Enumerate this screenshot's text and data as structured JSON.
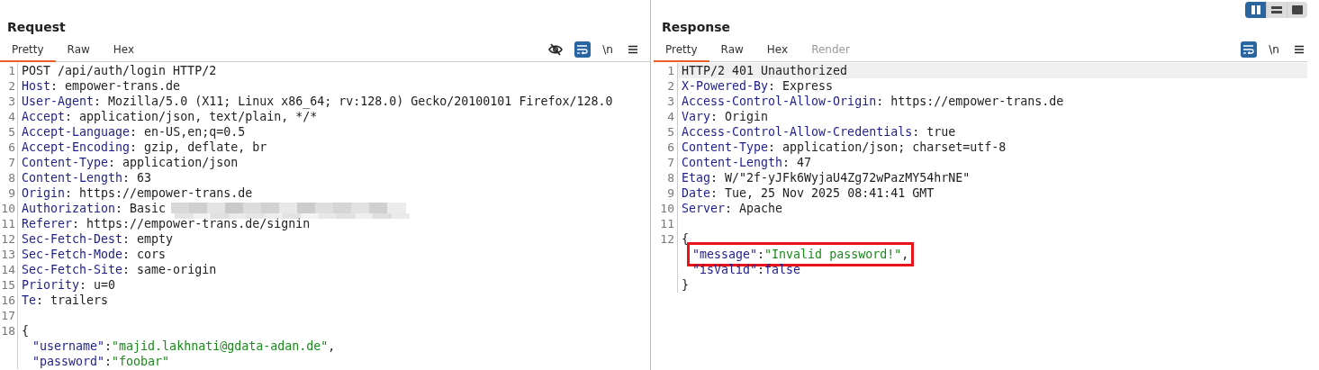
{
  "request": {
    "title": "Request",
    "tabs": [
      {
        "label": "Pretty",
        "selected": true,
        "disabled": false
      },
      {
        "label": "Raw",
        "selected": false,
        "disabled": false
      },
      {
        "label": "Hex",
        "selected": false,
        "disabled": false
      }
    ],
    "toolbar": [
      {
        "kind": "eye-off",
        "on": false
      },
      {
        "kind": "wrap",
        "on": true
      },
      {
        "kind": "newline",
        "label": "\\n",
        "on": false
      },
      {
        "kind": "menu",
        "on": false
      }
    ],
    "lines": [
      {
        "number": "1",
        "selected": false,
        "boxed": false,
        "indented": false,
        "tokens": [
          {
            "kind": "plain",
            "text": "POST /api/auth/login HTTP/2"
          }
        ]
      },
      {
        "number": "2",
        "selected": false,
        "boxed": false,
        "indented": false,
        "tokens": [
          {
            "kind": "key",
            "text": "Host"
          },
          {
            "kind": "plain",
            "text": ": empower-trans.de"
          }
        ]
      },
      {
        "number": "3",
        "selected": false,
        "boxed": false,
        "indented": false,
        "tokens": [
          {
            "kind": "key",
            "text": "User-Agent"
          },
          {
            "kind": "plain",
            "text": ": Mozilla/5.0 (X11; Linux x86_64; rv:128.0) Gecko/20100101 Firefox/128.0"
          }
        ]
      },
      {
        "number": "4",
        "selected": false,
        "boxed": false,
        "indented": false,
        "tokens": [
          {
            "kind": "key",
            "text": "Accept"
          },
          {
            "kind": "plain",
            "text": ": application/json, text/plain, */*"
          }
        ]
      },
      {
        "number": "5",
        "selected": false,
        "boxed": false,
        "indented": false,
        "tokens": [
          {
            "kind": "key",
            "text": "Accept-Language"
          },
          {
            "kind": "plain",
            "text": ": en-US,en;q=0.5"
          }
        ]
      },
      {
        "number": "6",
        "selected": false,
        "boxed": false,
        "indented": false,
        "tokens": [
          {
            "kind": "key",
            "text": "Accept-Encoding"
          },
          {
            "kind": "plain",
            "text": ": gzip, deflate, br"
          }
        ]
      },
      {
        "number": "7",
        "selected": false,
        "boxed": false,
        "indented": false,
        "tokens": [
          {
            "kind": "key",
            "text": "Content-Type"
          },
          {
            "kind": "plain",
            "text": ": application/json"
          }
        ]
      },
      {
        "number": "8",
        "selected": false,
        "boxed": false,
        "indented": false,
        "tokens": [
          {
            "kind": "key",
            "text": "Content-Length"
          },
          {
            "kind": "plain",
            "text": ": 63"
          }
        ]
      },
      {
        "number": "9",
        "selected": false,
        "boxed": false,
        "indented": false,
        "tokens": [
          {
            "kind": "key",
            "text": "Origin"
          },
          {
            "kind": "plain",
            "text": ": https://empower-trans.de"
          }
        ]
      },
      {
        "number": "10",
        "selected": false,
        "boxed": false,
        "indented": false,
        "tokens": [
          {
            "kind": "key",
            "text": "Authorization"
          },
          {
            "kind": "plain",
            "text": ": Basic"
          },
          {
            "kind": "blur"
          }
        ]
      },
      {
        "number": "11",
        "selected": false,
        "boxed": false,
        "indented": false,
        "tokens": [
          {
            "kind": "key",
            "text": "Referer"
          },
          {
            "kind": "plain",
            "text": ": https://empower-trans.de/signin"
          }
        ]
      },
      {
        "number": "12",
        "selected": false,
        "boxed": false,
        "indented": false,
        "tokens": [
          {
            "kind": "key",
            "text": "Sec-Fetch-Dest"
          },
          {
            "kind": "plain",
            "text": ": empty"
          }
        ]
      },
      {
        "number": "13",
        "selected": false,
        "boxed": false,
        "indented": false,
        "tokens": [
          {
            "kind": "key",
            "text": "Sec-Fetch-Mode"
          },
          {
            "kind": "plain",
            "text": ": cors"
          }
        ]
      },
      {
        "number": "14",
        "selected": false,
        "boxed": false,
        "indented": false,
        "tokens": [
          {
            "kind": "key",
            "text": "Sec-Fetch-Site"
          },
          {
            "kind": "plain",
            "text": ": same-origin"
          }
        ]
      },
      {
        "number": "15",
        "selected": false,
        "boxed": false,
        "indented": false,
        "tokens": [
          {
            "kind": "key",
            "text": "Priority"
          },
          {
            "kind": "plain",
            "text": ": u=0"
          }
        ]
      },
      {
        "number": "16",
        "selected": false,
        "boxed": false,
        "indented": false,
        "tokens": [
          {
            "kind": "key",
            "text": "Te"
          },
          {
            "kind": "plain",
            "text": ": trailers"
          }
        ]
      },
      {
        "number": "17",
        "selected": false
      },
      {
        "number": "18",
        "selected": false,
        "boxed": false,
        "indented": false,
        "tokens": [
          {
            "kind": "plain",
            "text": "{"
          }
        ]
      },
      {
        "selected": false,
        "boxed": false,
        "indented": true,
        "tokens": [
          {
            "kind": "key",
            "text": "\"username\""
          },
          {
            "kind": "plain",
            "text": ":"
          },
          {
            "kind": "string",
            "text": "\"majid.lakhnati@gdata-adan.de\""
          },
          {
            "kind": "plain",
            "text": ","
          }
        ]
      },
      {
        "selected": false,
        "boxed": false,
        "indented": true,
        "tokens": [
          {
            "kind": "key",
            "text": "\"password\""
          },
          {
            "kind": "plain",
            "text": ":"
          },
          {
            "kind": "string",
            "text": "\"foobar\""
          }
        ]
      }
    ]
  },
  "response": {
    "title": "Response",
    "view_toggles": [
      {
        "kind": "split-columns",
        "selected": true
      },
      {
        "kind": "split-rows",
        "selected": false
      },
      {
        "kind": "single",
        "selected": false
      }
    ],
    "tabs": [
      {
        "label": "Pretty",
        "selected": true,
        "disabled": false
      },
      {
        "label": "Raw",
        "selected": false,
        "disabled": false
      },
      {
        "label": "Hex",
        "selected": false,
        "disabled": false
      },
      {
        "label": "Render",
        "selected": false,
        "disabled": true
      }
    ],
    "toolbar": [
      {
        "kind": "wrap",
        "on": true
      },
      {
        "kind": "newline",
        "label": "\\n",
        "on": false
      },
      {
        "kind": "menu",
        "on": false
      }
    ],
    "lines": [
      {
        "number": "1",
        "selected": true,
        "boxed": false,
        "indented": false,
        "tokens": [
          {
            "kind": "plain",
            "text": "HTTP/2 401 Unauthorized"
          }
        ]
      },
      {
        "number": "2",
        "selected": false,
        "boxed": false,
        "indented": false,
        "tokens": [
          {
            "kind": "key",
            "text": "X-Powered-By"
          },
          {
            "kind": "plain",
            "text": ": Express"
          }
        ]
      },
      {
        "number": "3",
        "selected": false,
        "boxed": false,
        "indented": false,
        "tokens": [
          {
            "kind": "key",
            "text": "Access-Control-Allow-Origin"
          },
          {
            "kind": "plain",
            "text": ": https://empower-trans.de"
          }
        ]
      },
      {
        "number": "4",
        "selected": false,
        "boxed": false,
        "indented": false,
        "tokens": [
          {
            "kind": "key",
            "text": "Vary"
          },
          {
            "kind": "plain",
            "text": ": Origin"
          }
        ]
      },
      {
        "number": "5",
        "selected": false,
        "boxed": false,
        "indented": false,
        "tokens": [
          {
            "kind": "key",
            "text": "Access-Control-Allow-Credentials"
          },
          {
            "kind": "plain",
            "text": ": true"
          }
        ]
      },
      {
        "number": "6",
        "selected": false,
        "boxed": false,
        "indented": false,
        "tokens": [
          {
            "kind": "key",
            "text": "Content-Type"
          },
          {
            "kind": "plain",
            "text": ": application/json; charset=utf-8"
          }
        ]
      },
      {
        "number": "7",
        "selected": false,
        "boxed": false,
        "indented": false,
        "tokens": [
          {
            "kind": "key",
            "text": "Content-Length"
          },
          {
            "kind": "plain",
            "text": ": 47"
          }
        ]
      },
      {
        "number": "8",
        "selected": false,
        "boxed": false,
        "indented": false,
        "tokens": [
          {
            "kind": "key",
            "text": "Etag"
          },
          {
            "kind": "plain",
            "text": ": W/\"2f-yJFk6WyjaU4Zg72wPazMY54hrNE\""
          }
        ]
      },
      {
        "number": "9",
        "selected": false,
        "boxed": false,
        "indented": false,
        "tokens": [
          {
            "kind": "key",
            "text": "Date"
          },
          {
            "kind": "plain",
            "text": ": Tue, 25 Nov 2025 08:41:41 GMT"
          }
        ]
      },
      {
        "number": "10",
        "selected": false,
        "boxed": false,
        "indented": false,
        "tokens": [
          {
            "kind": "key",
            "text": "Server"
          },
          {
            "kind": "plain",
            "text": ": Apache"
          }
        ]
      },
      {
        "number": "11",
        "selected": false
      },
      {
        "number": "12",
        "selected": false,
        "boxed": false,
        "indented": false,
        "tokens": [
          {
            "kind": "plain",
            "text": "{"
          }
        ]
      },
      {
        "selected": false,
        "boxed": true,
        "indented": true,
        "tokens": [
          {
            "kind": "key",
            "text": "\"message\""
          },
          {
            "kind": "plain",
            "text": ":"
          },
          {
            "kind": "string",
            "text": "\"Invalid password!\""
          },
          {
            "kind": "plain",
            "text": ","
          }
        ]
      },
      {
        "selected": false,
        "boxed": false,
        "indented": true,
        "tokens": [
          {
            "kind": "key",
            "text": "\"isValid\""
          },
          {
            "kind": "plain",
            "text": ":"
          },
          {
            "kind": "literal",
            "text": "false"
          }
        ]
      },
      {
        "selected": false,
        "boxed": false,
        "indented": false,
        "tokens": [
          {
            "kind": "plain",
            "text": "}"
          }
        ]
      }
    ]
  }
}
